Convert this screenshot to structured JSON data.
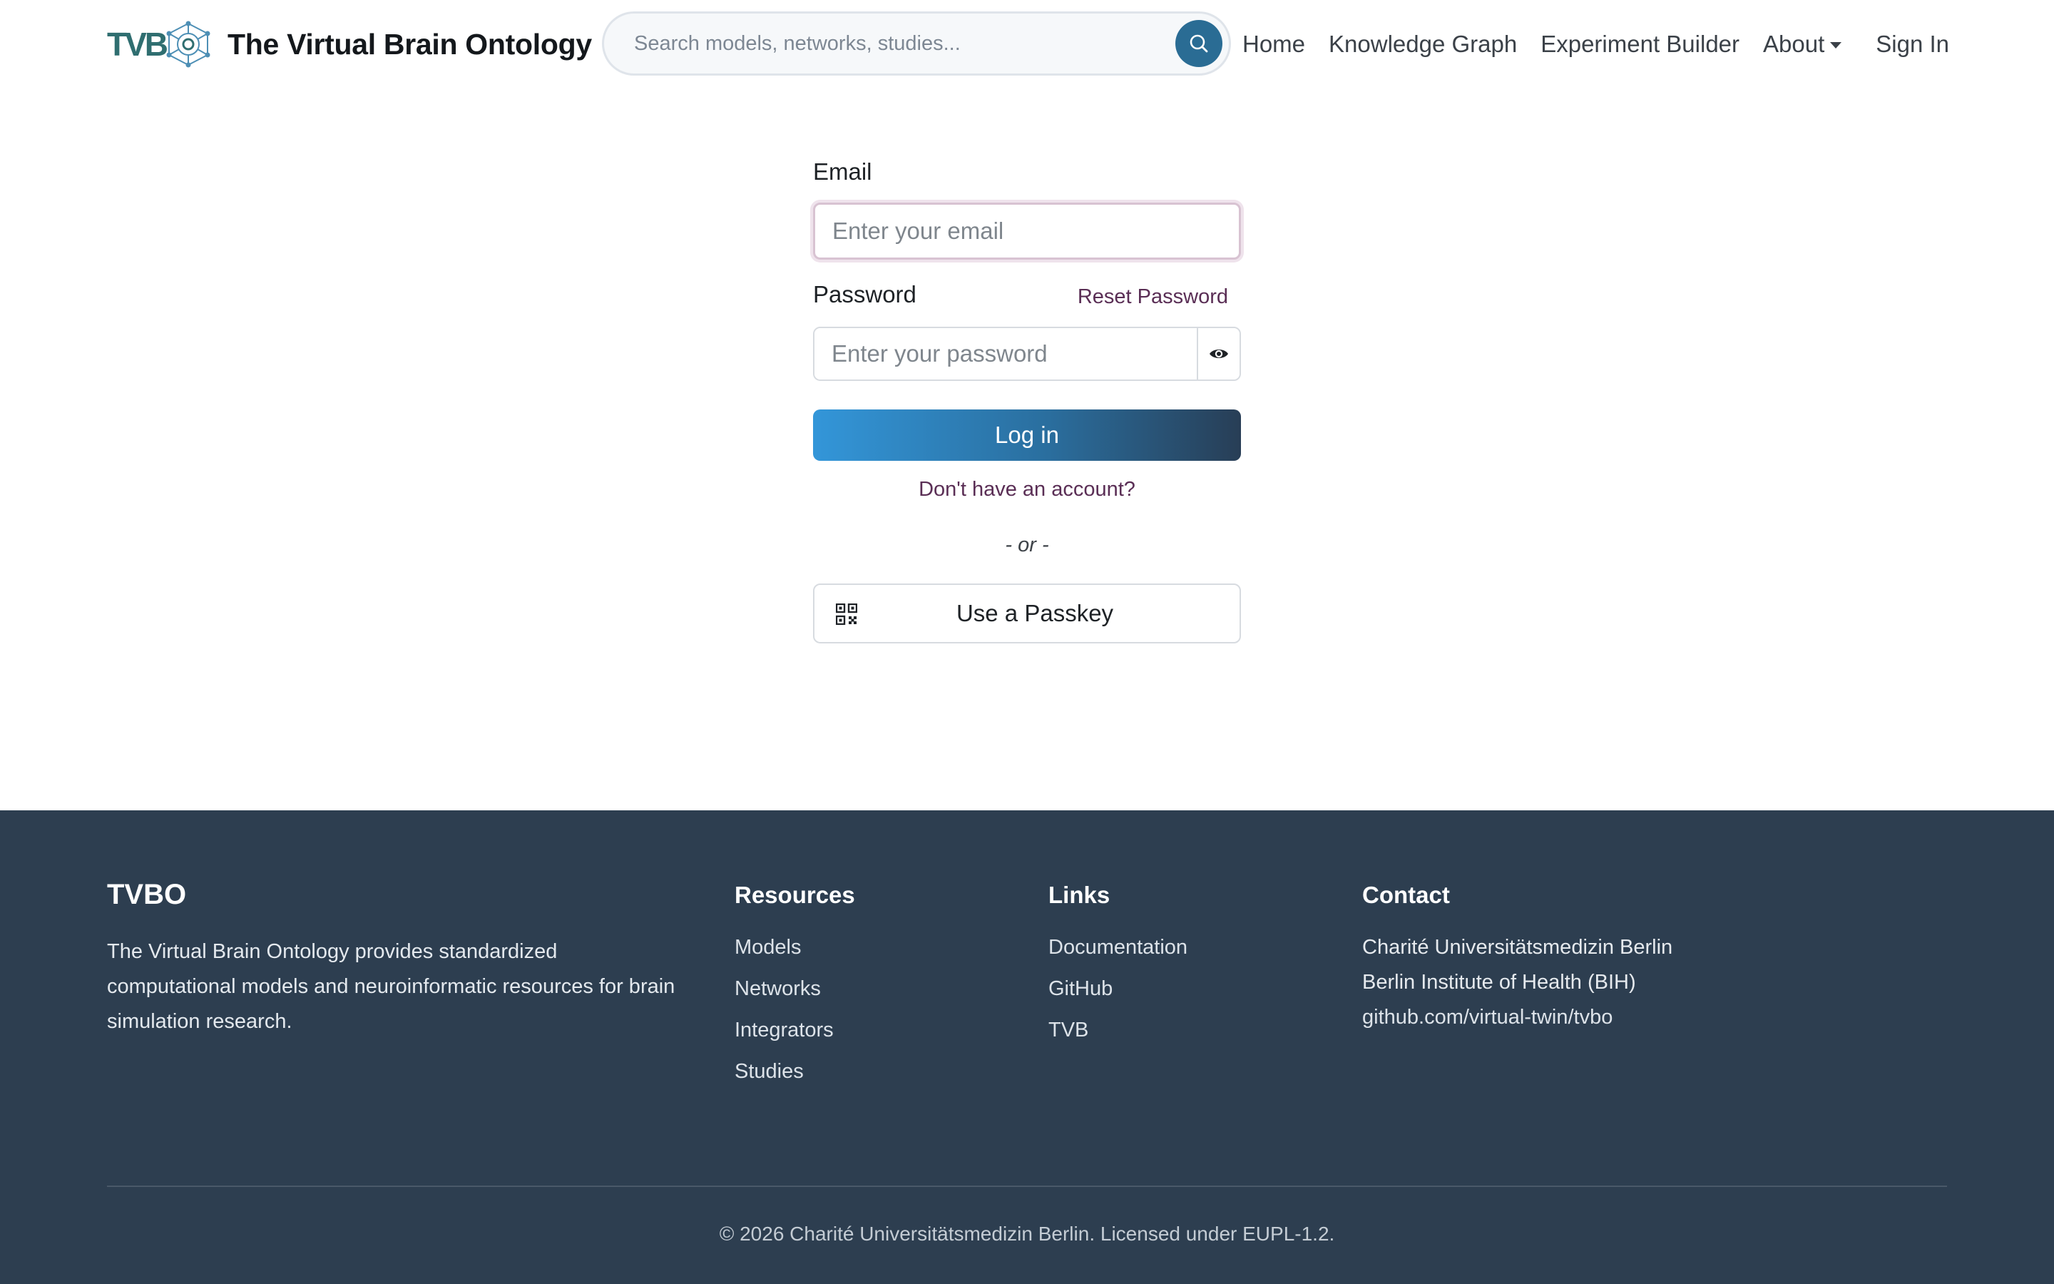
{
  "header": {
    "brand_logo_text": "TVB",
    "brand_title": "The Virtual Brain Ontology",
    "search": {
      "placeholder": "Search models, networks, studies...",
      "value": ""
    },
    "nav": {
      "home": "Home",
      "knowledge_graph": "Knowledge Graph",
      "experiment_builder": "Experiment Builder",
      "about": "About",
      "sign_in": "Sign In"
    }
  },
  "login_form": {
    "email_label": "Email",
    "email_placeholder": "Enter your email",
    "email_value": "",
    "password_label": "Password",
    "reset_password": "Reset Password",
    "password_placeholder": "Enter your password",
    "password_value": "",
    "login_button": "Log in",
    "signup_link": "Don't have an account?",
    "or_separator": "- or -",
    "passkey_button": "Use a Passkey"
  },
  "footer": {
    "brand": "TVBO",
    "description": "The Virtual Brain Ontology provides standardized computational models and neuroinformatic resources for brain simulation research.",
    "resources": {
      "heading": "Resources",
      "items": [
        "Models",
        "Networks",
        "Integrators",
        "Studies"
      ]
    },
    "links": {
      "heading": "Links",
      "items": [
        "Documentation",
        "GitHub",
        "TVB"
      ]
    },
    "contact": {
      "heading": "Contact",
      "lines": [
        "Charité Universitätsmedizin Berlin",
        "Berlin Institute of Health (BIH)"
      ],
      "link": "github.com/virtual-twin/tvbo"
    },
    "copyright": "© 2026 Charité Universitätsmedizin Berlin. Licensed under EUPL-1.2."
  },
  "icons": {
    "logo": "brain-network-logo-icon",
    "search": "search-icon",
    "password_toggle": "eye-icon",
    "passkey": "qr-code-icon"
  },
  "colors": {
    "accent_blue": "#2a6c94",
    "footer_bg": "#2d3e50",
    "link_plum": "#5a2e55",
    "logo_teal": "#2f6e70"
  }
}
